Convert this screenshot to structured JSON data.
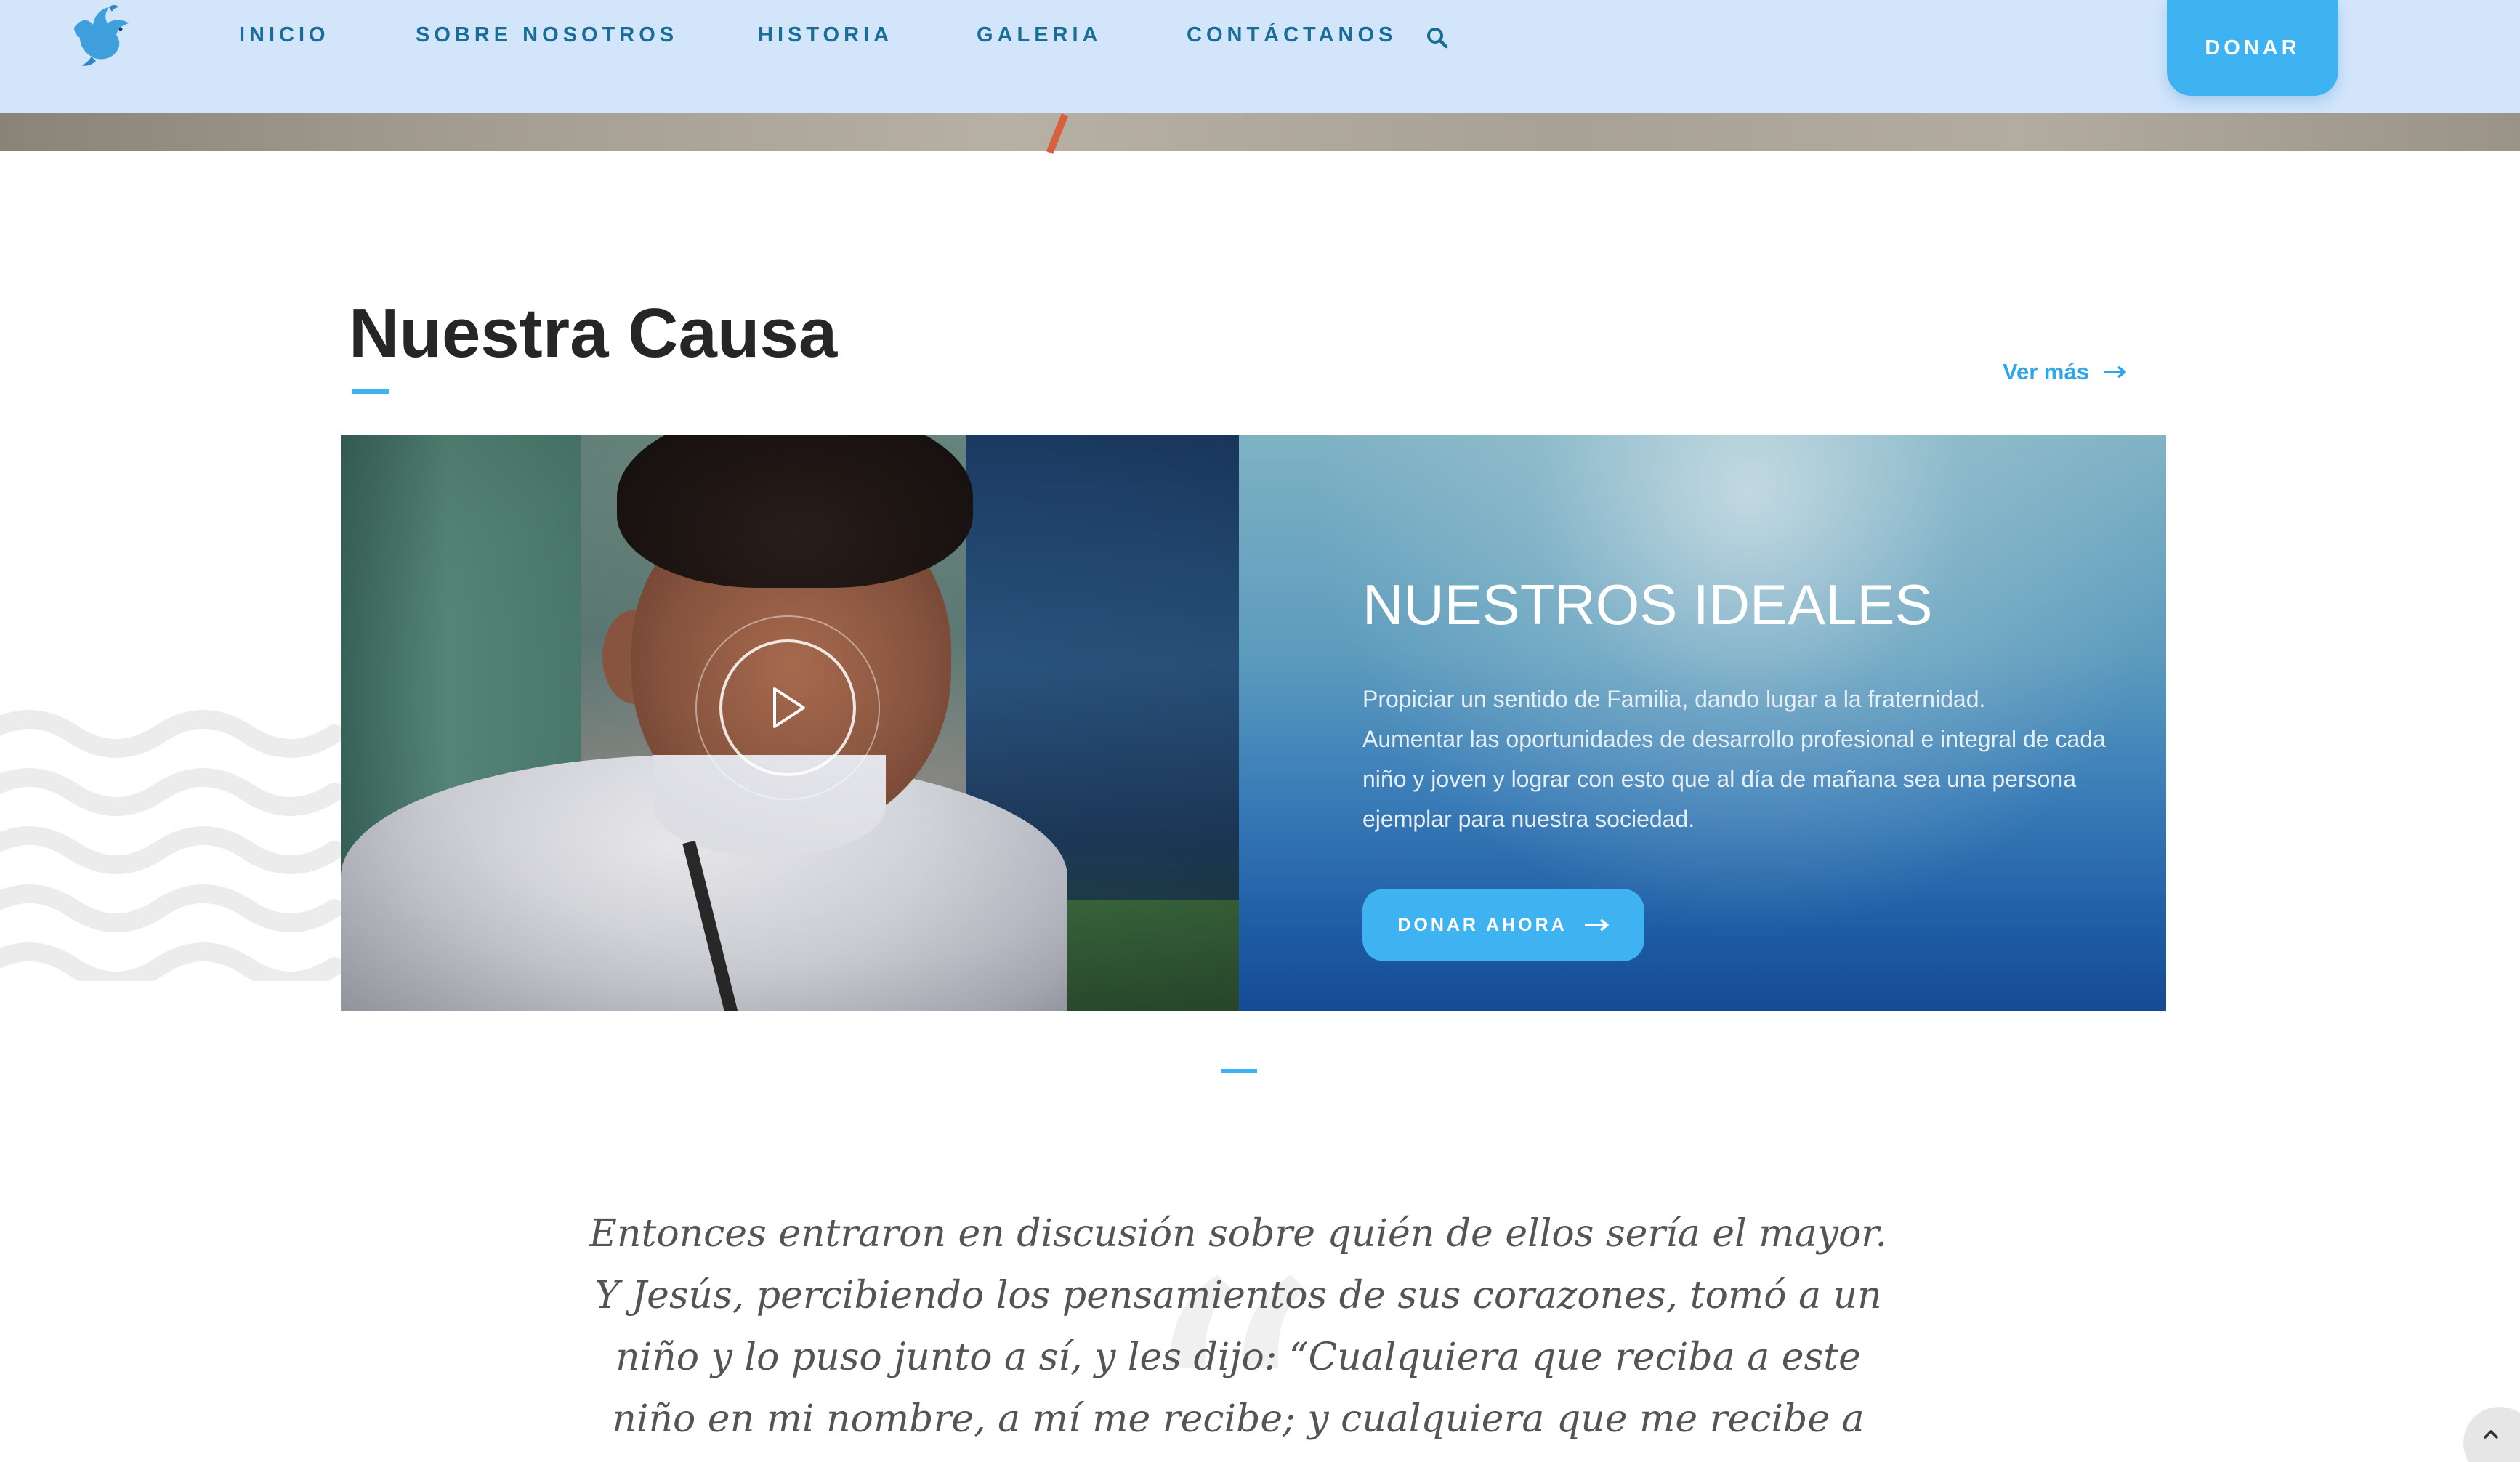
{
  "header": {
    "nav": [
      {
        "label": "INICIO"
      },
      {
        "label": "SOBRE NOSOTROS"
      },
      {
        "label": "HISTORIA"
      },
      {
        "label": "GALERIA"
      },
      {
        "label": "CONTÁCTANOS"
      }
    ],
    "donate_label": "DONAR"
  },
  "section": {
    "title": "Nuestra Causa",
    "ver_mas": "Ver más"
  },
  "ideals": {
    "title": "NUESTROS IDEALES",
    "lines": [
      "Propiciar un sentido de Familia, dando lugar a la fraternidad.",
      "Aumentar las oportunidades de desarrollo profesional e integral de cada",
      "niño y joven y lograr con esto que al día de mañana sea una persona",
      "ejemplar para nuestra sociedad."
    ],
    "button_label": "DONAR AHORA"
  },
  "quote": {
    "lines": [
      "Entonces entraron en discusión sobre quién de ellos sería el mayor.",
      "Y Jesús, percibiendo los pensamientos de sus corazones, tomó a un",
      "niño y lo puso junto a sí, y les dijo: “Cualquiera que reciba a este",
      "niño en mi nombre, a mí me recibe; y cualquiera que me recibe a"
    ]
  },
  "icons": {
    "logo": "dove-logo-icon",
    "search": "search-icon",
    "play": "play-icon",
    "arrow": "arrow-right-icon",
    "scroll_top": "chevron-up-icon"
  },
  "colors": {
    "header_bg": "#d2e5fb",
    "nav_text": "#1a6e96",
    "accent": "#3fb2f2",
    "link": "#2fa6ea",
    "title_text": "#262626",
    "quote_text": "#545454"
  }
}
